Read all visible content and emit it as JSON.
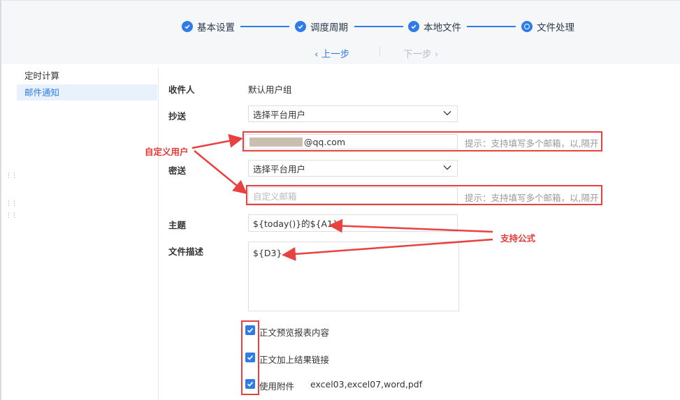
{
  "steps": [
    {
      "label": "基本设置"
    },
    {
      "label": "调度周期"
    },
    {
      "label": "本地文件"
    },
    {
      "label": "文件处理"
    }
  ],
  "nav": {
    "prev": "上一步",
    "next": "下一步"
  },
  "sidebar": {
    "items": [
      {
        "label": "定时计算"
      },
      {
        "label": "邮件通知"
      }
    ]
  },
  "form": {
    "recipient_label": "收件人",
    "recipient_value": "默认用户组",
    "cc_label": "抄送",
    "cc_select": "选择平台用户",
    "cc_custom_value": "@qq.com",
    "hint": "提示：支持填写多个邮箱，以,隔开",
    "bcc_label": "密送",
    "bcc_select": "选择平台用户",
    "bcc_custom_placeholder": "自定义邮箱",
    "subject_label": "主题",
    "subject_value": "${today()}的${A1}",
    "desc_label": "文件描述",
    "desc_value": "${D3}",
    "checkboxes": [
      {
        "label": "正文预览报表内容",
        "checked": true
      },
      {
        "label": "正文加上结果链接",
        "checked": true
      },
      {
        "label": "使用附件",
        "checked": true
      }
    ],
    "attachment_types": "excel03,excel07,word,pdf"
  },
  "annotations": {
    "custom_user": "自定义用户",
    "formula_support": "支持公式"
  },
  "colors": {
    "accent": "#2f7ce8",
    "annotation": "#e94040"
  }
}
